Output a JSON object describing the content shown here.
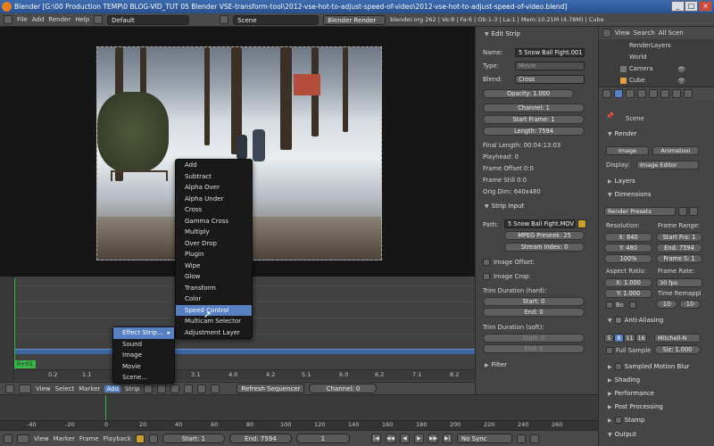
{
  "window": {
    "title": "Blender [G:\\00 Production TEMP\\0 BLOG-VID_TUT 05 Blender VSE-transform-tool\\2012-vse-hot-to-adjust-speed-of-video\\2012-vse-hot-to-adjust-speed-of-video.blend]",
    "min": "_",
    "max": "□",
    "close": "×"
  },
  "topbar": {
    "menus": [
      "File",
      "Add",
      "Render",
      "Help"
    ],
    "layout": "Default",
    "scene": "Scene",
    "engine": "Blender Render",
    "stats": "blender.org 262 | Ve:8 | Fa:6 | Ob:1-3 | La:1 | Mem:10.21M (4.78M) | Cube"
  },
  "effect_menu": {
    "items": [
      "Add",
      "Subtract",
      "Alpha Over",
      "Alpha Under",
      "Cross",
      "Gamma Cross",
      "Multiply",
      "Over Drop",
      "Plugin",
      "Wipe",
      "Glow",
      "Transform",
      "Color",
      "Speed Control",
      "Multicam Selector",
      "Adjustment Layer"
    ],
    "active": "Speed Control"
  },
  "add_menu": {
    "items": [
      "Effect Strip...",
      "Sound",
      "Image",
      "Movie",
      "Scene..."
    ],
    "active": "Effect Strip..."
  },
  "sequencer": {
    "frame_label": "0+01",
    "ruler": [
      "0.2",
      "1.1",
      "3.1",
      "4.0",
      "4.2",
      "5.1",
      "6.0",
      "6.2",
      "7.1",
      "8.2"
    ],
    "menus": [
      "View",
      "Select",
      "Marker",
      "Add",
      "Strip"
    ],
    "add_active": "Add",
    "refresh": "Refresh Sequencer",
    "channel": "Channel: 0"
  },
  "timeline": {
    "ruler": [
      "-40",
      "-20",
      "0",
      "20",
      "40",
      "60",
      "80",
      "100",
      "120",
      "140",
      "160",
      "180",
      "200",
      "220",
      "240",
      "260"
    ],
    "menus": [
      "View",
      "Marker",
      "Frame",
      "Playback"
    ],
    "start": "Start: 1",
    "end": "End: 7594",
    "current": "1",
    "sync": "No Sync"
  },
  "strip_panel": {
    "edit_header": "Edit Strip",
    "name_label": "Name:",
    "name": "5 Snow Ball Fight.001",
    "type_label": "Type:",
    "type": "Movie",
    "blend_label": "Blend:",
    "blend": "Cross",
    "opacity": "Opacity: 1.000",
    "channel": "Channel: 1",
    "start": "Start Frame: 1",
    "length": "Length: 7594",
    "info": [
      "Final Length: 00:04:13:03",
      "Playhead: 0",
      "Frame Offset 0:0",
      "Frame Still 0:0",
      "Orig Dim: 640x480"
    ],
    "input_header": "Strip Input",
    "path_label": "Path:",
    "path": "5 Snow Ball Fight.MOV",
    "mpeg": "MPEG Preseek: 25",
    "stream": "Stream Index: 0",
    "image_offset": "Image Offset:",
    "image_crop": "Image Crop:",
    "trim_hard": "Trim Duration (hard):",
    "trim_hard_start": "Start: 0",
    "trim_hard_end": "End: 0",
    "trim_soft": "Trim Duration (soft):",
    "trim_soft_start": "Start: 0",
    "trim_soft_end": "End: 0",
    "filter_header": "Filter"
  },
  "outliner": {
    "menus": [
      "View",
      "Search",
      "All Scen"
    ],
    "items": [
      "RenderLayers",
      "World",
      "Camera",
      "Cube"
    ]
  },
  "render_props": {
    "scene": "Scene",
    "render_header": "Render",
    "image_btn": "Image",
    "animation_btn": "Animation",
    "display_label": "Display:",
    "display": "Image Editor",
    "layers": "Layers",
    "dimensions": "Dimensions",
    "presets": "Render Presets",
    "resolution": "Resolution:",
    "res_x": "X: 640",
    "res_y": "Y: 480",
    "res_pct": "100%",
    "frame_range": "Frame Range:",
    "fr_start": "Start Fra: 1",
    "fr_end": "End: 7594",
    "fr_step": "Frame S: 1",
    "aspect": "Aspect Ratio:",
    "asp_x": "X: 1.000",
    "asp_y": "Y: 1.000",
    "bo": "Bo",
    "frame_rate": "Frame Rate:",
    "fps": "30 fps",
    "time_remap": "Time Remappi",
    "remap_old": "·10·",
    "remap_new": "·10·",
    "aa": "Anti-Aliasing",
    "aa_samples": [
      "5",
      "8",
      "11",
      "16"
    ],
    "aa_active": "8",
    "aa_filter": "Mitchell-N",
    "full_sample": "Full Sample",
    "aa_size": "Siz: 1.000",
    "sections": [
      "Sampled Motion Blur",
      "Shading",
      "Performance",
      "Post Processing",
      "Stamp",
      "Output"
    ]
  }
}
